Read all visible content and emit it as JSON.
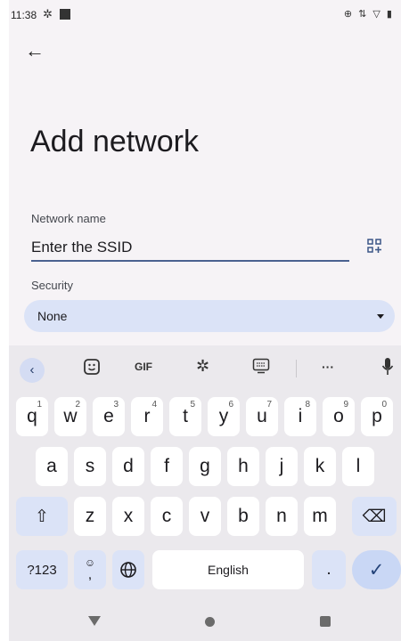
{
  "status_bar": {
    "time": "11:38",
    "icons_right": "⊕ ⇅ ▽ ▮"
  },
  "page": {
    "title": "Add network",
    "network_name_label": "Network name",
    "ssid_placeholder": "Enter the SSID",
    "security_label": "Security",
    "security_value": "None"
  },
  "keyboard": {
    "toolbar": {
      "gif_label": "GIF",
      "more_label": "···"
    },
    "row1": [
      {
        "key": "q",
        "hint": "1"
      },
      {
        "key": "w",
        "hint": "2"
      },
      {
        "key": "e",
        "hint": "3"
      },
      {
        "key": "r",
        "hint": "4"
      },
      {
        "key": "t",
        "hint": "5"
      },
      {
        "key": "y",
        "hint": "6"
      },
      {
        "key": "u",
        "hint": "7"
      },
      {
        "key": "i",
        "hint": "8"
      },
      {
        "key": "o",
        "hint": "9"
      },
      {
        "key": "p",
        "hint": "0"
      }
    ],
    "row2": [
      "a",
      "s",
      "d",
      "f",
      "g",
      "h",
      "j",
      "k",
      "l"
    ],
    "row3": [
      "z",
      "x",
      "c",
      "v",
      "b",
      "n",
      "m"
    ],
    "symbols_label": "?123",
    "comma_label": ",",
    "space_label": "English",
    "period_label": "."
  },
  "colors": {
    "accent": "#4a6190",
    "select_bg": "#dbe3f7",
    "keyboard_bg": "#ebe9ed"
  }
}
